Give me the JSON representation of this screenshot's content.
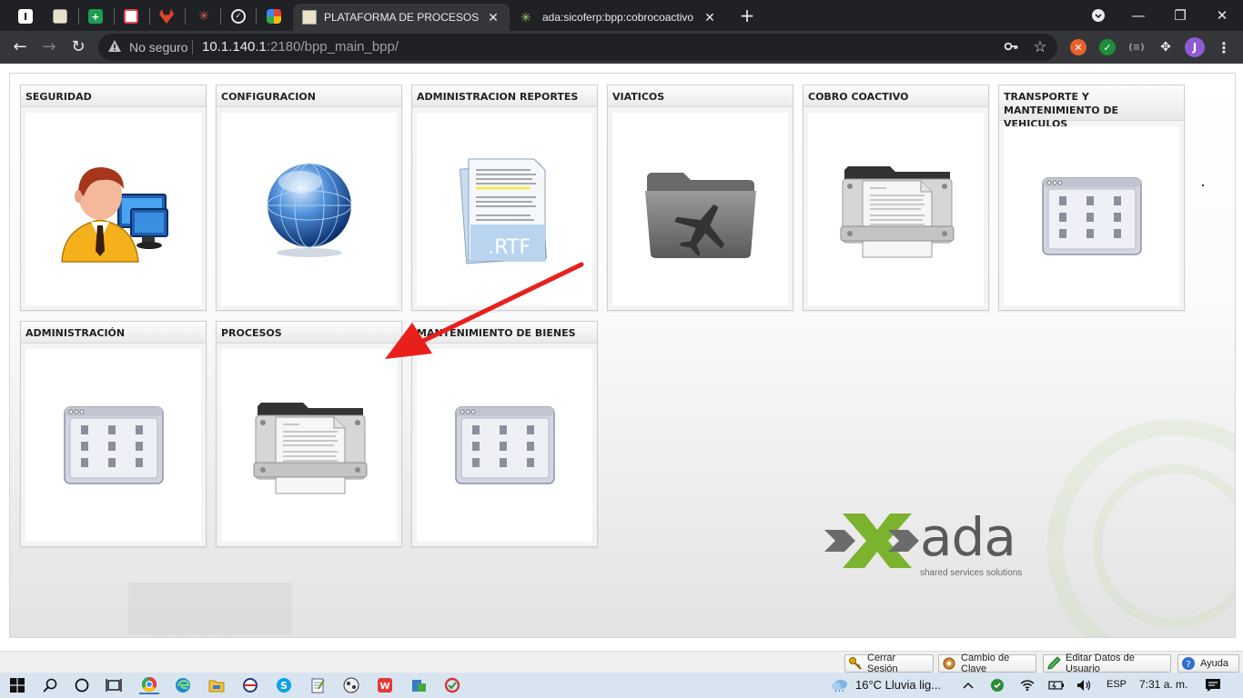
{
  "browser": {
    "tabs": [
      {
        "title": "PLATAFORMA DE PROCESOS DE BPP",
        "active": true
      },
      {
        "title": "ada:sicoferp:bpp:cobrocoactivo",
        "active": false
      }
    ],
    "address": {
      "security_label": "No seguro",
      "url_host": "10.1.140.1",
      "url_rest": ":2180/bpp_main_bpp/"
    },
    "profile_initial": "J"
  },
  "modules": [
    {
      "label": "SEGURIDAD",
      "icon": "user-network-icon"
    },
    {
      "label": "CONFIGURACION",
      "icon": "globe-icon"
    },
    {
      "label": "ADMINISTRACION REPORTES",
      "icon": "rtf-document-icon"
    },
    {
      "label": "VIATICOS",
      "icon": "airplane-folder-icon"
    },
    {
      "label": "COBRO COACTIVO",
      "icon": "document-folder-icon"
    },
    {
      "label": "TRANSPORTE Y MANTENIMIENTO DE VEHICULOS",
      "icon": "app-window-icon"
    },
    {
      "label": "ADMINISTRACIÓN",
      "icon": "app-window-icon"
    },
    {
      "label": "PROCESOS",
      "icon": "document-folder-icon"
    },
    {
      "label": "MANTENIMIENTO DE BIENES",
      "icon": "app-window-icon"
    }
  ],
  "rtf_badge": ".RTF",
  "logo": {
    "word": "ada",
    "tagline": "shared services solutions"
  },
  "footer": {
    "logout": "Cerrar Sesión",
    "change_key": "Cambio de Clave",
    "edit_user": "Editar Datos de Usuario",
    "help": "Ayuda"
  },
  "taskbar": {
    "weather": "16°C  Lluvia lig...",
    "language": "ESP",
    "time": "7:31 a. m."
  },
  "colors": {
    "chrome_dark": "#202124",
    "chrome_toolbar": "#35363a",
    "arrow": "#e8201c",
    "ada_green": "#7bb32e"
  }
}
